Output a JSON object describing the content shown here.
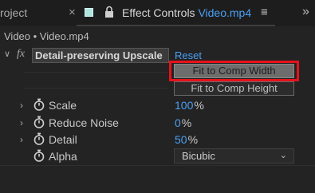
{
  "tabs": {
    "project_partial": "roject",
    "close_symbol": "×",
    "active_prefix": "Effect Controls ",
    "active_file": "Video.mp4",
    "menu_symbol": "≡",
    "overflow_symbol": "»"
  },
  "breadcrumb": "Video • Video.mp4",
  "effect": {
    "name": "Detail-preserving Upscale",
    "fx_label": "fx",
    "reset_label": "Reset",
    "buttons": {
      "fit_width": "Fit to Comp Width",
      "fit_height": "Fit to Comp Height"
    }
  },
  "properties": [
    {
      "label": "Scale",
      "value": "100",
      "unit": "%"
    },
    {
      "label": "Reduce Noise",
      "value": "0",
      "unit": "%"
    },
    {
      "label": "Detail",
      "value": "50",
      "unit": "%"
    }
  ],
  "alpha": {
    "label": "Alpha",
    "selected": "Bicubic"
  },
  "colors": {
    "accent_blue": "#4a9ff5",
    "highlight_red": "#e8111a",
    "panel_bg": "#232323"
  },
  "icons": {
    "expand": "chevron-right-icon",
    "collapse": "chevron-down-icon",
    "stopwatch": "stopwatch-icon",
    "lock": "lock-icon"
  }
}
